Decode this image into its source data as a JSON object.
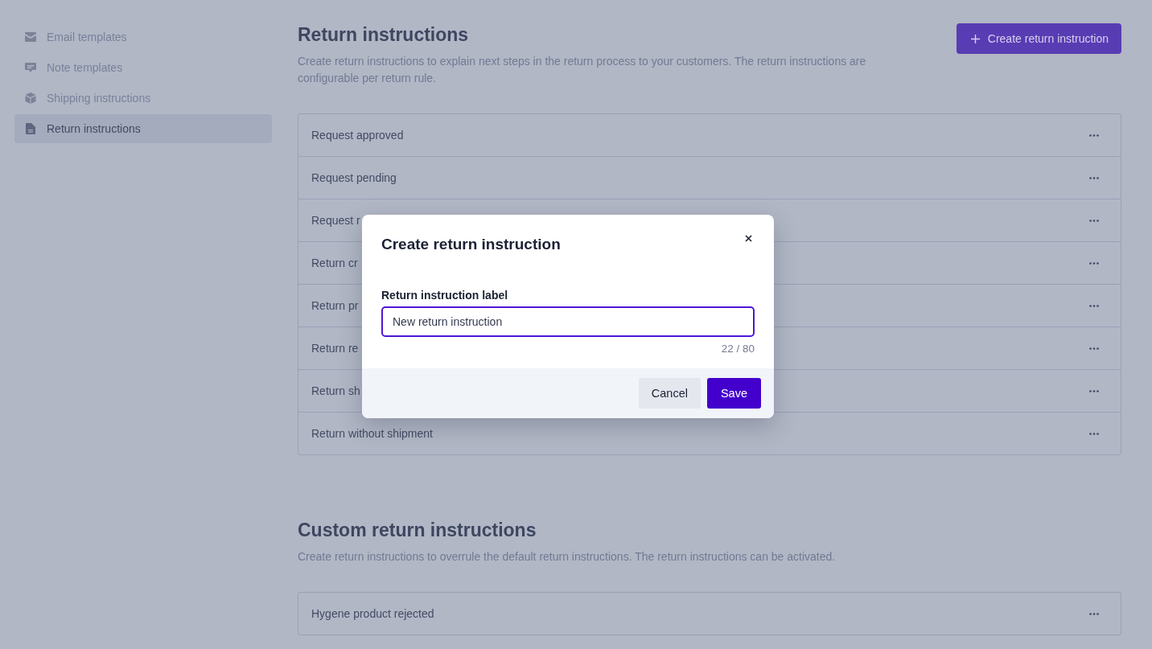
{
  "sidebar": {
    "items": [
      {
        "label": "Email templates",
        "selected": false
      },
      {
        "label": "Note templates",
        "selected": false
      },
      {
        "label": "Shipping instructions",
        "selected": false
      },
      {
        "label": "Return instructions",
        "selected": true
      }
    ]
  },
  "sections": [
    {
      "title": "Return instructions",
      "description": "Create return instructions to explain next steps in the return process to your customers. The return instructions are configurable per return rule.",
      "button": "Create return instruction",
      "rows": [
        {
          "label": "Request approved"
        },
        {
          "label": "Request pending"
        },
        {
          "label": "Request r"
        },
        {
          "label": "Return cr"
        },
        {
          "label": "Return pr"
        },
        {
          "label": "Return re"
        },
        {
          "label": "Return sh"
        },
        {
          "label": "Return without shipment"
        }
      ]
    },
    {
      "title": "Custom return instructions",
      "description": "Create return instructions to overrule the default return instructions. The return instructions can be activated.",
      "rows": [
        {
          "label": "Hygene product rejected"
        }
      ]
    }
  ],
  "modal": {
    "title": "Create return instruction",
    "field_label": "Return instruction label",
    "value": "New return instruction",
    "counter": "22 / 80",
    "buttons": [
      "Cancel",
      "Save"
    ]
  }
}
